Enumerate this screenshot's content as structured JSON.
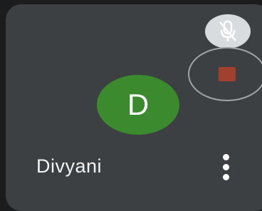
{
  "participant": {
    "name": "Divyani",
    "initial": "D",
    "avatar_color": "#3b8a2e",
    "mic_status": "muted"
  },
  "icons": {
    "mute": "mic-off-icon",
    "record": "stop-recording-icon",
    "more": "more-options-icon"
  },
  "colors": {
    "tile_bg": "#3c4043",
    "page_bg": "#1b1c1e",
    "mute_badge_bg": "#d9dcdf",
    "stop_square": "#a2402f"
  }
}
